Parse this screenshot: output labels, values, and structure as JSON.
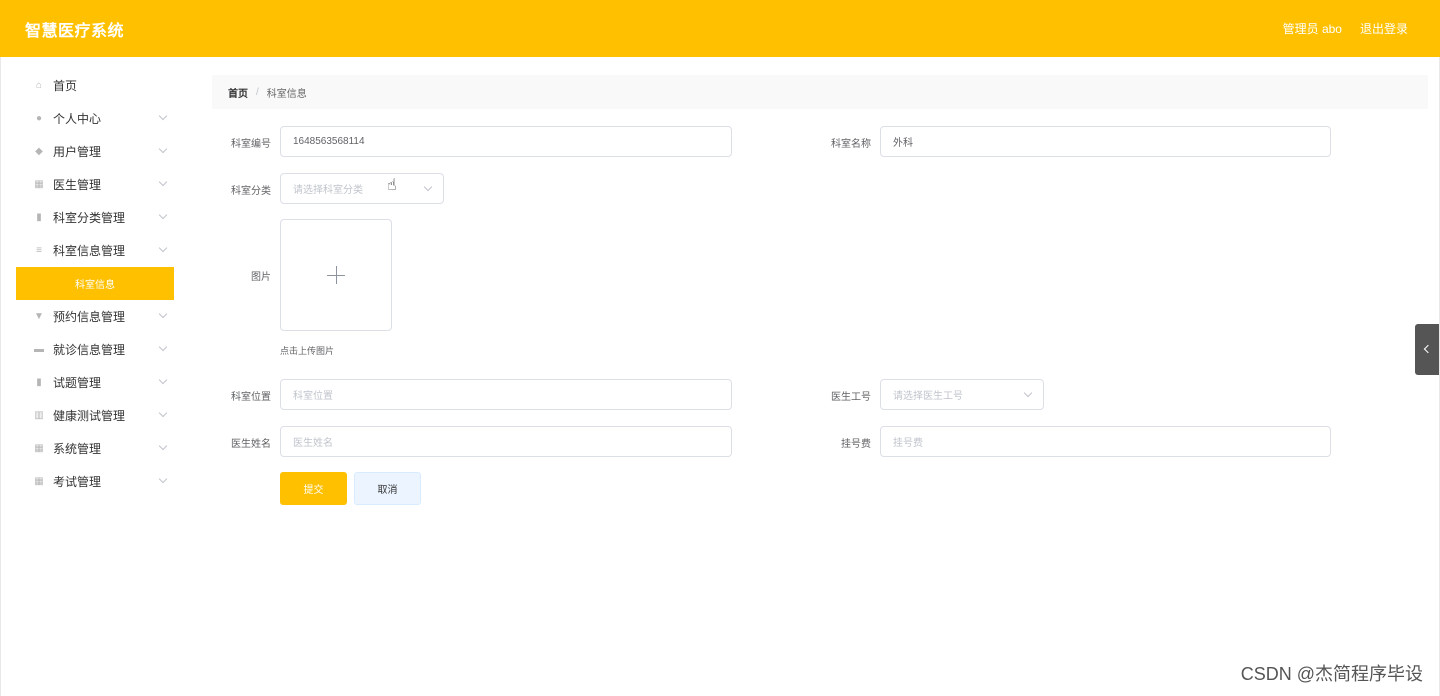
{
  "header": {
    "title": "智慧医疗系统",
    "user": "管理员 abo",
    "logout": "退出登录",
    "background": "#ffc000"
  },
  "sidebar": {
    "items": [
      {
        "label": "首页",
        "icon": "home-icon",
        "glyph": "⌂",
        "has_children": false
      },
      {
        "label": "个人中心",
        "icon": "user-icon",
        "glyph": "●",
        "has_children": true
      },
      {
        "label": "用户管理",
        "icon": "shield-icon",
        "glyph": "◆",
        "has_children": true
      },
      {
        "label": "医生管理",
        "icon": "grid-icon",
        "glyph": "▦",
        "has_children": true
      },
      {
        "label": "科室分类管理",
        "icon": "clipboard-icon",
        "glyph": "▮",
        "has_children": true
      },
      {
        "label": "科室信息管理",
        "icon": "list-icon",
        "glyph": "≡",
        "has_children": true
      },
      {
        "label": "预约信息管理",
        "icon": "cup-icon",
        "glyph": "▼",
        "has_children": true
      },
      {
        "label": "就诊信息管理",
        "icon": "suitcase-icon",
        "glyph": "▬",
        "has_children": true
      },
      {
        "label": "试题管理",
        "icon": "clipboard-icon",
        "glyph": "▮",
        "has_children": true
      },
      {
        "label": "健康测试管理",
        "icon": "bars-icon",
        "glyph": "▥",
        "has_children": true
      },
      {
        "label": "系统管理",
        "icon": "grid-icon",
        "glyph": "▦",
        "has_children": true
      },
      {
        "label": "考试管理",
        "icon": "table-icon",
        "glyph": "▦",
        "has_children": true
      }
    ],
    "active_submenu": "科室信息",
    "accent": "#ffc000"
  },
  "breadcrumb": {
    "home": "首页",
    "separator": "/",
    "current": "科室信息"
  },
  "form": {
    "dept_no": {
      "label": "科室编号",
      "value": "1648563568114"
    },
    "dept_name": {
      "label": "科室名称",
      "value": "外科"
    },
    "dept_category": {
      "label": "科室分类",
      "placeholder": "请选择科室分类"
    },
    "image": {
      "label": "图片",
      "tip": "点击上传图片"
    },
    "dept_location": {
      "label": "科室位置",
      "placeholder": "科室位置"
    },
    "doctor_id": {
      "label": "医生工号",
      "placeholder": "请选择医生工号"
    },
    "doctor_name": {
      "label": "医生姓名",
      "placeholder": "医生姓名"
    },
    "reg_fee": {
      "label": "挂号费",
      "placeholder": "挂号费"
    },
    "submit": "提交",
    "cancel": "取消"
  },
  "watermark": "CSDN @杰简程序毕设"
}
